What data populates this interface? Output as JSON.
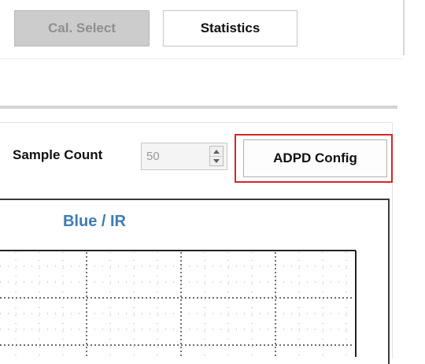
{
  "toolbar": {
    "cal_select_label": "Cal. Select",
    "statistics_label": "Statistics"
  },
  "controls": {
    "sample_count_label": "Sample Count",
    "sample_count_value": "50",
    "adpd_config_label": "ADPD Config"
  },
  "chart": {
    "title": "Blue / IR"
  },
  "chart_data": {
    "type": "line",
    "title": "Blue / IR",
    "series": [],
    "grid": true
  },
  "colors": {
    "chart_title": "#3e7bb5",
    "highlight_frame": "#d6262a",
    "disabled_button": "#cccccc"
  },
  "icons": {
    "spin_up": "triangle-up-icon",
    "spin_down": "triangle-down-icon"
  }
}
